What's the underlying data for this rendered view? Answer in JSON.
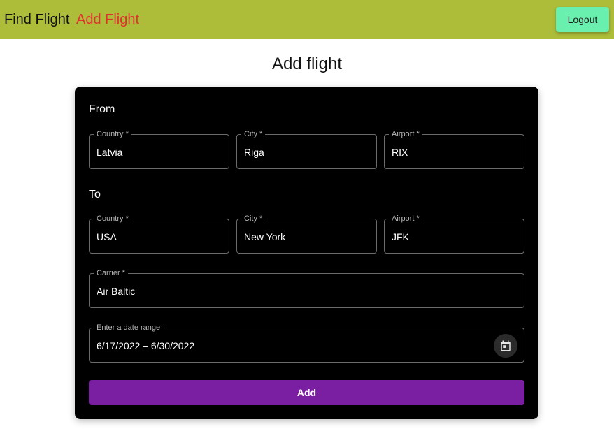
{
  "nav": {
    "find_flight": "Find Flight",
    "add_flight": "Add Flight",
    "logout": "Logout"
  },
  "page": {
    "title": "Add flight"
  },
  "form": {
    "from": {
      "heading": "From",
      "country": {
        "label": "Country *",
        "value": "Latvia"
      },
      "city": {
        "label": "City *",
        "value": "Riga"
      },
      "airport": {
        "label": "Airport *",
        "value": "RIX"
      }
    },
    "to": {
      "heading": "To",
      "country": {
        "label": "Country *",
        "value": "USA"
      },
      "city": {
        "label": "City *",
        "value": "New York"
      },
      "airport": {
        "label": "Airport *",
        "value": "JFK"
      }
    },
    "carrier": {
      "label": "Carrier *",
      "value": "Air Baltic"
    },
    "date_range": {
      "label": "Enter a date range",
      "value": "6/17/2022 – 6/30/2022"
    },
    "submit_label": "Add"
  },
  "icons": {
    "date_picker": "calendar-icon"
  },
  "colors": {
    "topbar": "#adbd39",
    "active_nav": "#e03131",
    "logout_button": "#69f0ae",
    "submit_button": "#7b1fa2",
    "card_background": "#000000"
  }
}
